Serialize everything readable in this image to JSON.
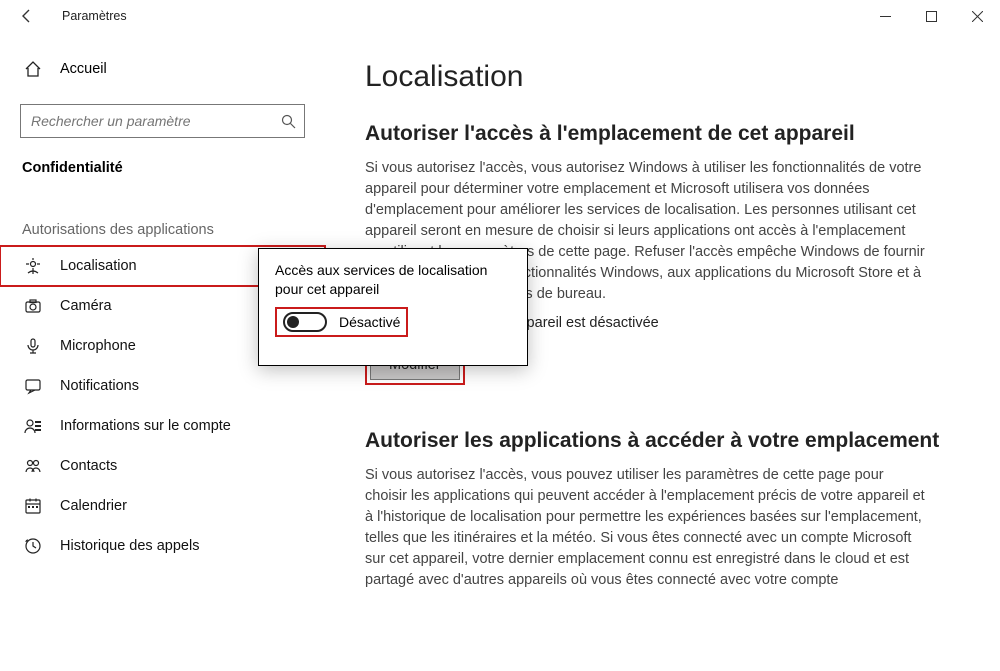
{
  "window": {
    "title": "Paramètres"
  },
  "sidebar": {
    "home_label": "Accueil",
    "search_placeholder": "Rechercher un paramètre",
    "section_label": "Confidentialité",
    "section_sub": "Autorisations des applications",
    "items": [
      {
        "icon": "location",
        "label": "Localisation",
        "selected": true
      },
      {
        "icon": "camera",
        "label": "Caméra"
      },
      {
        "icon": "microphone",
        "label": "Microphone"
      },
      {
        "icon": "notifications",
        "label": "Notifications"
      },
      {
        "icon": "account",
        "label": "Informations sur le compte"
      },
      {
        "icon": "contacts",
        "label": "Contacts"
      },
      {
        "icon": "calendar",
        "label": "Calendrier"
      },
      {
        "icon": "callhistory",
        "label": "Historique des appels"
      }
    ]
  },
  "content": {
    "page_title": "Localisation",
    "section1": {
      "heading": "Autoriser l'accès à l'emplacement de cet appareil",
      "body": "Si vous autorisez l'accès, vous autorisez Windows à utiliser les fonctionnalités de votre appareil pour déterminer votre emplacement et Microsoft utilisera vos données d'emplacement pour améliorer les services de localisation. Les personnes utilisant cet appareil seront en mesure de choisir si leurs applications ont accès à l'emplacement en utilisant les paramètres de cette page. Refuser l'accès empêche Windows de fournir un emplacement aux fonctionnalités Windows, aux applications du Microsoft Store et à la plupart des applications de bureau.",
      "status": "L'emplacement de cet appareil est désactivée",
      "button": "Modifier"
    },
    "section2": {
      "heading": "Autoriser les applications à accéder à votre emplacement",
      "body": "Si vous autorisez l'accès, vous pouvez utiliser les paramètres de cette page pour choisir les applications qui peuvent accéder à l'emplacement précis de votre appareil et à l'historique de localisation pour permettre les expériences basées sur l'emplacement, telles que les itinéraires et la météo. Si vous êtes connecté avec un compte Microsoft sur cet appareil, votre dernier emplacement connu est enregistré dans le cloud et est partagé avec d'autres appareils où vous êtes connecté avec votre compte"
    }
  },
  "popup": {
    "title": "Accès aux services de localisation pour cet appareil",
    "toggle_state": "off",
    "toggle_label": "Désactivé"
  }
}
